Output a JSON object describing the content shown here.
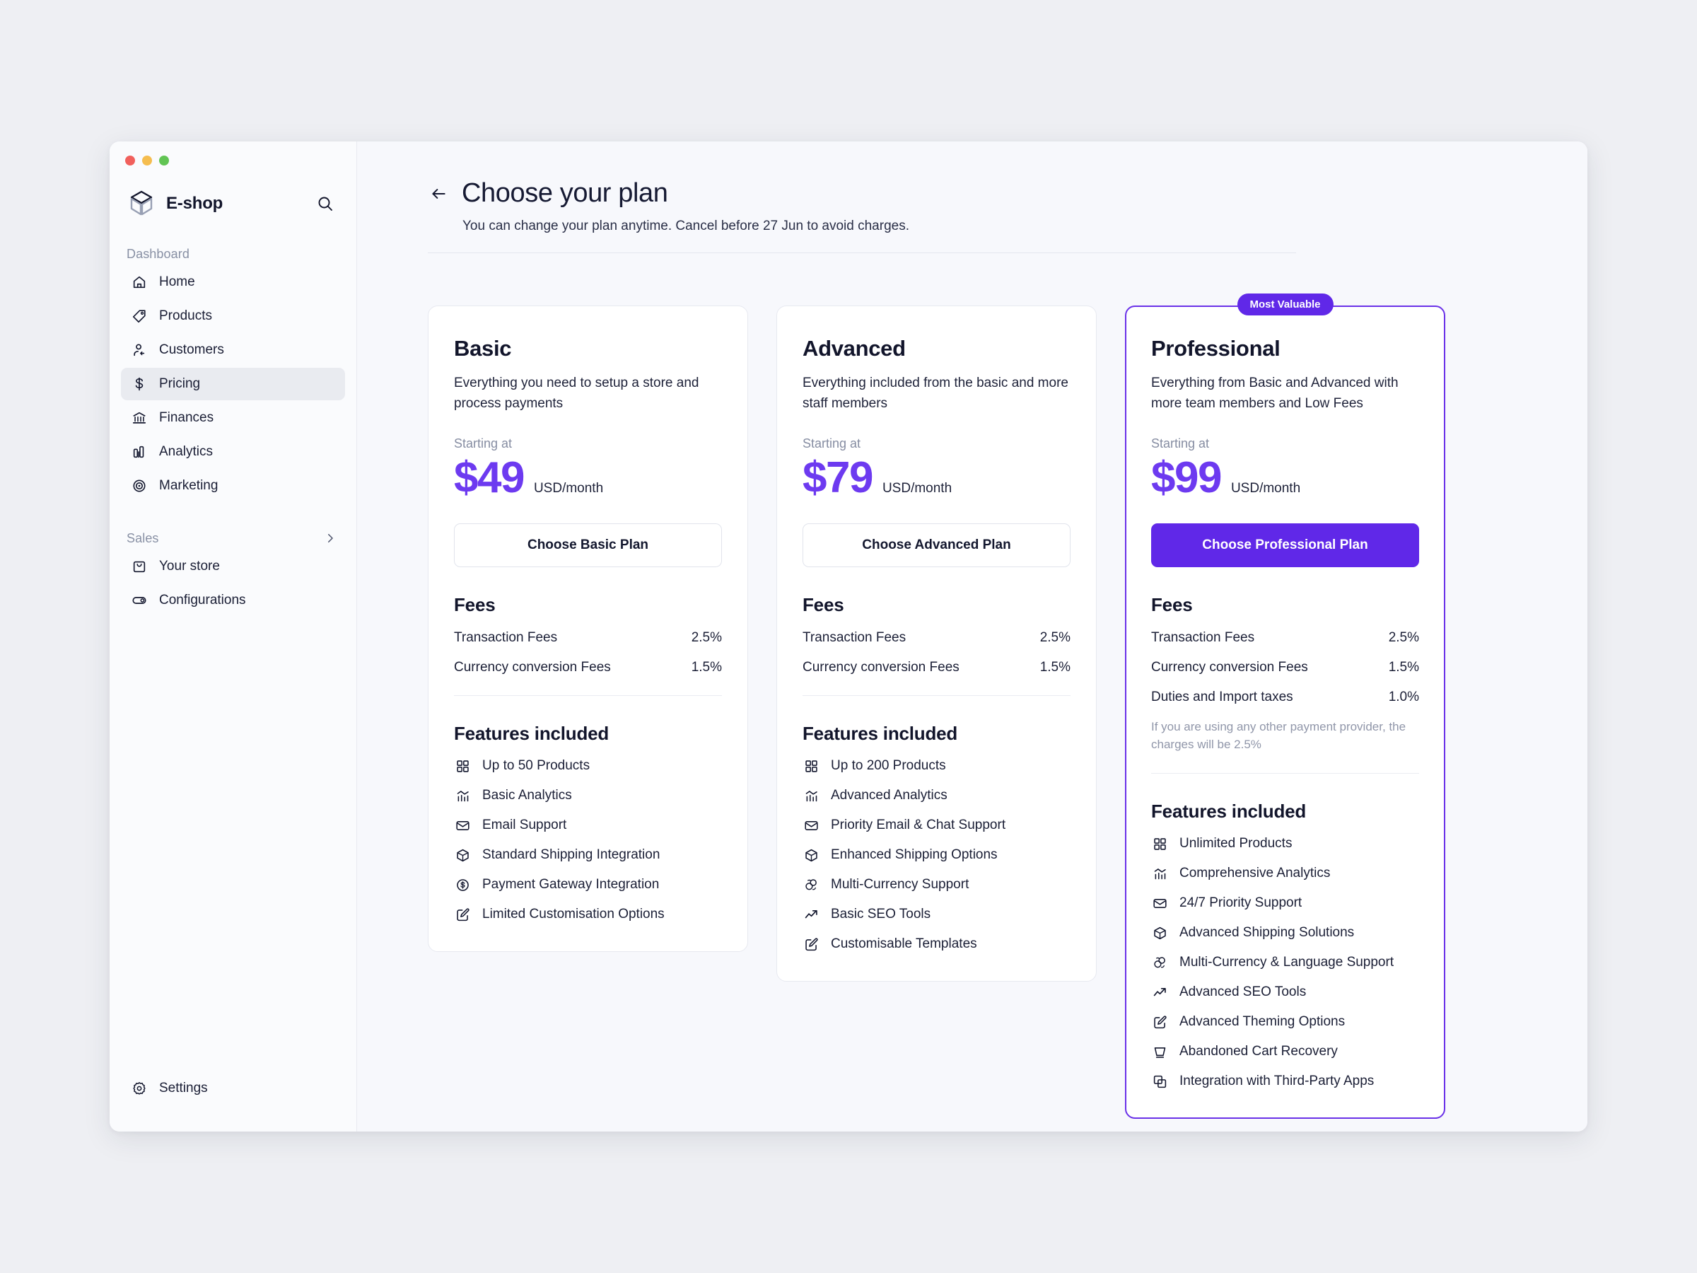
{
  "window": {
    "traffic_lights": [
      "close",
      "minimize",
      "maximize"
    ]
  },
  "sidebar": {
    "brand": "E-shop",
    "search_icon": "search-icon",
    "sections": [
      {
        "label": "Dashboard",
        "has_chevron": false,
        "items": [
          {
            "label": "Home",
            "icon": "home-icon",
            "active": false
          },
          {
            "label": "Products",
            "icon": "tag-icon",
            "active": false
          },
          {
            "label": "Customers",
            "icon": "users-icon",
            "active": false
          },
          {
            "label": "Pricing",
            "icon": "dollar-icon",
            "active": true
          },
          {
            "label": "Finances",
            "icon": "bank-icon",
            "active": false
          },
          {
            "label": "Analytics",
            "icon": "bar-chart-icon",
            "active": false
          },
          {
            "label": "Marketing",
            "icon": "target-icon",
            "active": false
          }
        ]
      },
      {
        "label": "Sales",
        "has_chevron": true,
        "chevron_icon": "chevron-right-icon",
        "items": [
          {
            "label": "Your store",
            "icon": "shopping-bag-icon",
            "active": false
          },
          {
            "label": "Configurations",
            "icon": "toggle-icon",
            "active": false
          }
        ]
      }
    ],
    "footer": {
      "label": "Settings",
      "icon": "gear-icon"
    }
  },
  "header": {
    "back_icon": "arrow-left-icon",
    "title": "Choose your plan",
    "subtitle": "You can change your plan anytime. Cancel before 27 Jun to avoid charges."
  },
  "labels": {
    "starting_at": "Starting at",
    "price_unit": "USD/month",
    "fees_title": "Fees",
    "features_title": "Features included"
  },
  "colors": {
    "accent": "#6028E8",
    "price": "#6D3AF0",
    "badge_bg": "#6028E8",
    "card_border": "#E7E9F0",
    "featured_border": "#6A31E8"
  },
  "plans": [
    {
      "name": "Basic",
      "description": "Everything you need to setup a store and process payments",
      "price": "$49",
      "cta": "Choose Basic Plan",
      "featured": false,
      "badge": null,
      "fees": [
        {
          "label": "Transaction Fees",
          "value": "2.5%"
        },
        {
          "label": "Currency conversion Fees",
          "value": "1.5%"
        }
      ],
      "fee_note": null,
      "features": [
        {
          "label": "Up to 50 Products",
          "icon": "grid-icon"
        },
        {
          "label": "Basic Analytics",
          "icon": "analytics-icon"
        },
        {
          "label": "Email Support",
          "icon": "mail-icon"
        },
        {
          "label": "Standard Shipping Integration",
          "icon": "box-icon"
        },
        {
          "label": "Payment Gateway Integration",
          "icon": "coin-icon"
        },
        {
          "label": "Limited Customisation Options",
          "icon": "edit-icon"
        }
      ]
    },
    {
      "name": "Advanced",
      "description": "Everything included from the basic and more staff members",
      "price": "$79",
      "cta": "Choose Advanced Plan",
      "featured": false,
      "badge": null,
      "fees": [
        {
          "label": "Transaction Fees",
          "value": "2.5%"
        },
        {
          "label": "Currency conversion Fees",
          "value": "1.5%"
        }
      ],
      "fee_note": null,
      "features": [
        {
          "label": "Up to 200 Products",
          "icon": "grid-icon"
        },
        {
          "label": "Advanced Analytics",
          "icon": "analytics-icon"
        },
        {
          "label": "Priority Email & Chat Support",
          "icon": "mail-icon"
        },
        {
          "label": "Enhanced Shipping Options",
          "icon": "box-icon"
        },
        {
          "label": "Multi-Currency Support",
          "icon": "currency-icon"
        },
        {
          "label": "Basic SEO Tools",
          "icon": "trend-up-icon"
        },
        {
          "label": "Customisable Templates",
          "icon": "edit-icon"
        }
      ]
    },
    {
      "name": "Professional",
      "description": "Everything from Basic and Advanced with more team members and Low Fees",
      "price": "$99",
      "cta": "Choose Professional Plan",
      "featured": true,
      "badge": "Most Valuable",
      "fees": [
        {
          "label": "Transaction Fees",
          "value": "2.5%"
        },
        {
          "label": "Currency conversion Fees",
          "value": "1.5%"
        },
        {
          "label": "Duties and Import taxes",
          "value": "1.0%"
        }
      ],
      "fee_note": "If you are using any other payment provider, the charges will be 2.5%",
      "features": [
        {
          "label": "Unlimited Products",
          "icon": "grid-icon"
        },
        {
          "label": "Comprehensive Analytics",
          "icon": "analytics-icon"
        },
        {
          "label": "24/7 Priority Support",
          "icon": "mail-icon"
        },
        {
          "label": "Advanced Shipping Solutions",
          "icon": "box-icon"
        },
        {
          "label": "Multi-Currency & Language Support",
          "icon": "currency-icon"
        },
        {
          "label": "Advanced SEO Tools",
          "icon": "trend-up-icon"
        },
        {
          "label": "Advanced Theming Options",
          "icon": "edit-icon"
        },
        {
          "label": "Abandoned Cart Recovery",
          "icon": "cart-icon"
        },
        {
          "label": "Integration with Third-Party Apps",
          "icon": "apps-icon"
        }
      ]
    }
  ]
}
